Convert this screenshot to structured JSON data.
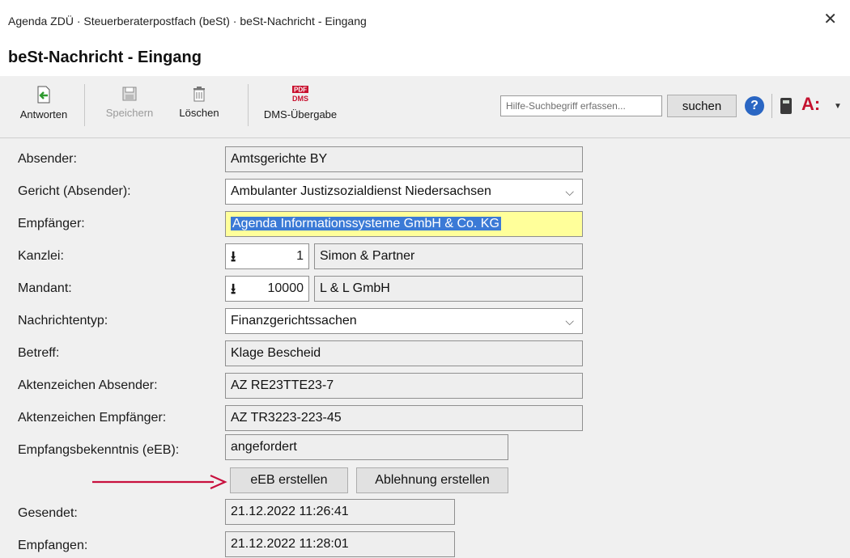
{
  "window": {
    "title": "Agenda ZDÜ · Steuerberaterpostfach (beSt) · beSt-Nachricht - Eingang",
    "close_glyph": "✕",
    "heading": "beSt-Nachricht - Eingang"
  },
  "toolbar": {
    "antworten": "Antworten",
    "speichern": "Speichern",
    "loeschen": "Löschen",
    "dms": "DMS-Übergabe",
    "dms_icon_top": "PDF",
    "dms_icon_bottom": "DMS",
    "help_placeholder": "Hilfe-Suchbegriff erfassen...",
    "suchen": "suchen",
    "help_glyph": "?",
    "logo": "A:",
    "logo_menu_glyph": "▼"
  },
  "form": {
    "absender_label": "Absender:",
    "absender_value": "Amtsgerichte BY",
    "gericht_label": "Gericht (Absender):",
    "gericht_value": "Ambulanter Justizsozialdienst Niedersachsen",
    "empfaenger_label": "Empfänger:",
    "empfaenger_value": "Agenda Informationssysteme GmbH & Co. KG",
    "kanzlei_label": "Kanzlei:",
    "kanzlei_number": "1",
    "kanzlei_name": "Simon & Partner",
    "mandant_label": "Mandant:",
    "mandant_number": "10000",
    "mandant_name": "L & L GmbH",
    "nachrichtentyp_label": "Nachrichtentyp:",
    "nachrichtentyp_value": "Finanzgerichtssachen",
    "betreff_label": "Betreff:",
    "betreff_value": "Klage Bescheid",
    "az_absender_label": "Aktenzeichen Absender:",
    "az_absender_value": "AZ RE23TTE23-7",
    "az_empfaenger_label": "Aktenzeichen Empfänger:",
    "az_empfaenger_value": "AZ TR3223-223-45",
    "eeb_label": "Empfangsbekenntnis (eEB):",
    "eeb_value": "angefordert",
    "eeb_button": "eEB erstellen",
    "ablehnung_button": "Ablehnung erstellen",
    "gesendet_label": "Gesendet:",
    "gesendet_value": "21.12.2022 11:26:41",
    "empfangen_label": "Empfangen:",
    "empfangen_value": "21.12.2022 11:28:01",
    "download_glyph": "⭳",
    "chevron_glyph": "⌵"
  },
  "colors": {
    "annotation_arrow": "#c8103e",
    "brand_logo": "#c4122f",
    "selection": "#3b7ad6"
  }
}
